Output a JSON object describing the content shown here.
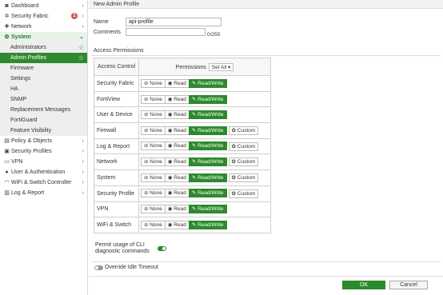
{
  "sidebar": {
    "items": [
      {
        "icon": "dashboard-icon",
        "glyph": "◙",
        "label": "Dashboard"
      },
      {
        "icon": "security-fabric-icon",
        "glyph": "✲",
        "label": "Security Fabric",
        "badge": "1"
      },
      {
        "icon": "network-icon",
        "glyph": "✚",
        "label": "Network"
      },
      {
        "icon": "gear-icon",
        "glyph": "✿",
        "label": "System"
      },
      {
        "label": "Administrators"
      },
      {
        "label": "Admin Profiles"
      },
      {
        "label": "Firmware"
      },
      {
        "label": "Settings"
      },
      {
        "label": "HA"
      },
      {
        "label": "SNMP"
      },
      {
        "label": "Replacement Messages"
      },
      {
        "label": "FortiGuard"
      },
      {
        "label": "Feature Visibility"
      },
      {
        "icon": "policy-icon",
        "glyph": "▤",
        "label": "Policy & Objects"
      },
      {
        "icon": "lock-icon",
        "glyph": "▣",
        "label": "Security Profiles"
      },
      {
        "icon": "vpn-icon",
        "glyph": "▭",
        "label": "VPN"
      },
      {
        "icon": "user-icon",
        "glyph": "●",
        "label": "User & Authentication"
      },
      {
        "icon": "wifi-icon",
        "glyph": "◠",
        "label": "WiFi & Switch Controller"
      },
      {
        "icon": "chart-icon",
        "glyph": "▥",
        "label": "Log & Report"
      }
    ]
  },
  "header": {
    "title": "New Admin Profile"
  },
  "form": {
    "name_label": "Name",
    "name_value": "api-profile",
    "comments_label": "Comments",
    "comments_counter": "0/255"
  },
  "access": {
    "section_title": "Access Permissions",
    "col_control": "Access Control",
    "col_permissions": "Permissions",
    "set_all": "Set All",
    "options": {
      "none": "None",
      "read": "Read",
      "readwrite": "Read/Write",
      "custom": "Custom"
    },
    "rows": [
      {
        "label": "Security Fabric",
        "custom": false
      },
      {
        "label": "FortiView",
        "custom": false
      },
      {
        "label": "User & Device",
        "custom": false
      },
      {
        "label": "Firewall",
        "custom": true
      },
      {
        "label": "Log & Report",
        "custom": true
      },
      {
        "label": "Network",
        "custom": true
      },
      {
        "label": "System",
        "custom": true
      },
      {
        "label": "Security Profile",
        "custom": true
      },
      {
        "label": "VPN",
        "custom": false
      },
      {
        "label": "WiFi & Switch",
        "custom": false
      }
    ]
  },
  "cli": {
    "label_line1": "Permit usage of CLI",
    "label_line2": "diagnostic commands",
    "enabled": true
  },
  "idle": {
    "label": "Override Idle Timeout",
    "enabled": false
  },
  "footer": {
    "ok_label": "OK",
    "cancel_label": "Cancel"
  },
  "colors": {
    "accent": "#2c8a2c",
    "badge": "#d9534f"
  }
}
